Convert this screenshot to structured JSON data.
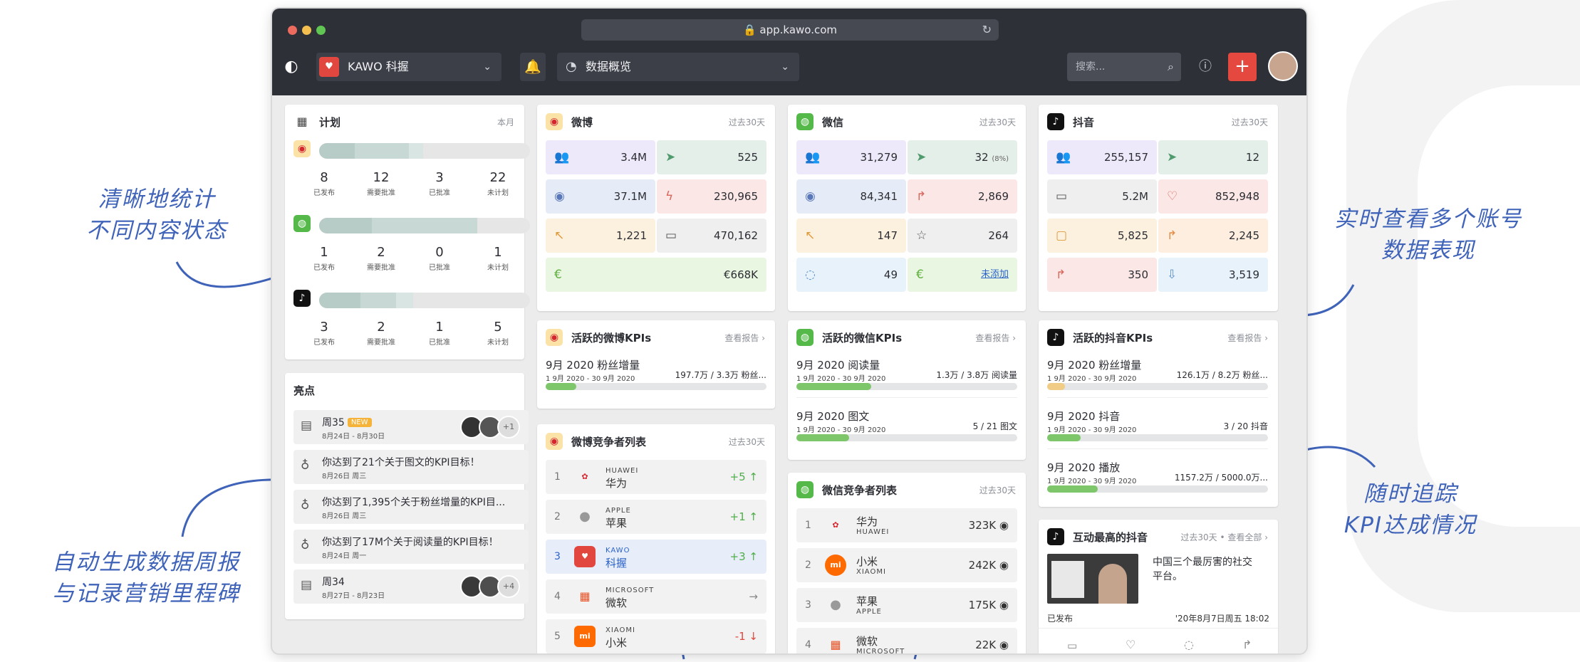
{
  "browser": {
    "url": "app.kawo.com"
  },
  "header": {
    "workspace": "KAWO 科握",
    "view": "数据概览",
    "search_placeholder": "搜索..."
  },
  "annotations": {
    "a1_line1": "清晰地统计",
    "a1_line2": "不同内容状态",
    "a2_line1": "自动生成数据周报",
    "a2_line2": "与记录营销里程碑",
    "a3_line1": "实时查看多个账号",
    "a3_line2": "数据表现",
    "a4_line1": "随时追踪",
    "a4_line2": "KPI达成情况"
  },
  "plan": {
    "title": "计划",
    "period": "本月",
    "labels": [
      "已发布",
      "需要批准",
      "已批准",
      "未计划"
    ],
    "rows": [
      {
        "platform": "weibo",
        "values": [
          "8",
          "12",
          "3",
          "22"
        ]
      },
      {
        "platform": "wechat",
        "values": [
          "1",
          "2",
          "0",
          "1"
        ]
      },
      {
        "platform": "douyin",
        "values": [
          "3",
          "2",
          "1",
          "5"
        ]
      }
    ]
  },
  "highlights": {
    "title": "亮点",
    "items": [
      {
        "text": "周35",
        "badge": "NEW",
        "date": "8月24日 - 8月30日",
        "extra": "+1"
      },
      {
        "text": "你达到了21个关于图文的KPI目标！",
        "date": "8月26日 周三"
      },
      {
        "text": "你达到了1,395个关于粉丝增量的KPI目...",
        "date": "8月26日 周三"
      },
      {
        "text": "你达到了17M个关于阅读量的KPI目标！",
        "date": "8月24日 周一"
      },
      {
        "text": "周34",
        "date": "8月27日 - 8月23日",
        "extra": "+4"
      }
    ]
  },
  "weibo": {
    "title": "微博",
    "period": "过去30天",
    "metrics": [
      "3.4M",
      "525",
      "37.1M",
      "230,965",
      "1,221",
      "470,162",
      "€668K"
    ],
    "kpi_title": "活跃的微博KPIs",
    "kpi_link": "查看报告 ›",
    "kpis": [
      {
        "name": "9月 2020 粉丝增量",
        "date": "1 9月 2020 - 30 9月 2020",
        "value": "197.7万 / 3.3万 粉丝...",
        "progress": 0.14
      }
    ],
    "comp_title": "微博竞争者列表",
    "comp_period": "过去30天",
    "competitors": [
      {
        "rank": "1",
        "en": "HUAWEI",
        "zh": "华为",
        "change": "+5 ↑"
      },
      {
        "rank": "2",
        "en": "APPLE",
        "zh": "苹果",
        "change": "+1 ↑"
      },
      {
        "rank": "3",
        "en": "KAWO",
        "zh": "科握",
        "change": "+3 ↑"
      },
      {
        "rank": "4",
        "en": "MICROSOFT",
        "zh": "微软",
        "change": "→"
      },
      {
        "rank": "5",
        "en": "XIAOMI",
        "zh": "小米",
        "change": "-1 ↓"
      }
    ]
  },
  "wechat": {
    "title": "微信",
    "period": "过去30天",
    "metrics": [
      "31,279",
      "32",
      "(8%)",
      "84,341",
      "2,869",
      "147",
      "264",
      "49",
      "未添加"
    ],
    "kpi_title": "活跃的微信KPIs",
    "kpi_link": "查看报告 ›",
    "kpis": [
      {
        "name": "9月 2020 阅读量",
        "date": "1 9月 2020 - 30 9月 2020",
        "value": "1.3万 / 3.8万 阅读量",
        "progress": 0.34
      },
      {
        "name": "9月 2020 图文",
        "date": "1 9月 2020 - 30 9月 2020",
        "value": "5 / 21 图文",
        "progress": 0.24
      }
    ],
    "comp_title": "微信竞争者列表",
    "comp_period": "过去30天",
    "competitors": [
      {
        "rank": "1",
        "zh": "华为",
        "en": "HUAWEI",
        "value": "323K"
      },
      {
        "rank": "2",
        "zh": "小米",
        "en": "XIAOMI",
        "value": "242K"
      },
      {
        "rank": "3",
        "zh": "苹果",
        "en": "APPLE",
        "value": "175K"
      },
      {
        "rank": "4",
        "zh": "微软",
        "en": "MICROSOFT",
        "value": "22K"
      }
    ]
  },
  "douyin": {
    "title": "抖音",
    "period": "过去30天",
    "metrics": [
      "255,157",
      "12",
      "5.2M",
      "852,948",
      "5,825",
      "2,245",
      "350",
      "3,519"
    ],
    "kpi_title": "活跃的抖音KPIs",
    "kpi_link": "查看报告 ›",
    "kpis": [
      {
        "name": "9月 2020 粉丝增量",
        "date": "1 9月 2020 - 30 9月 2020",
        "value": "126.1万 / 8.2万 粉丝...",
        "progress": 0.08
      },
      {
        "name": "9月 2020 抖音",
        "date": "1 9月 2020 - 30 9月 2020",
        "value": "3 / 20 抖音",
        "progress": 0.15
      },
      {
        "name": "9月 2020 播放",
        "date": "1 9月 2020 - 30 9月 2020",
        "value": "1157.2万 / 5000.0万...",
        "progress": 0.23
      }
    ],
    "top_title": "互动最高的抖音",
    "top_meta": "过去30天 • 查看全部 ›",
    "top_text": "中国三个最厉害的社交平台。",
    "top_status": "已发布",
    "top_date": "'20年8月7日周五 18:02"
  }
}
